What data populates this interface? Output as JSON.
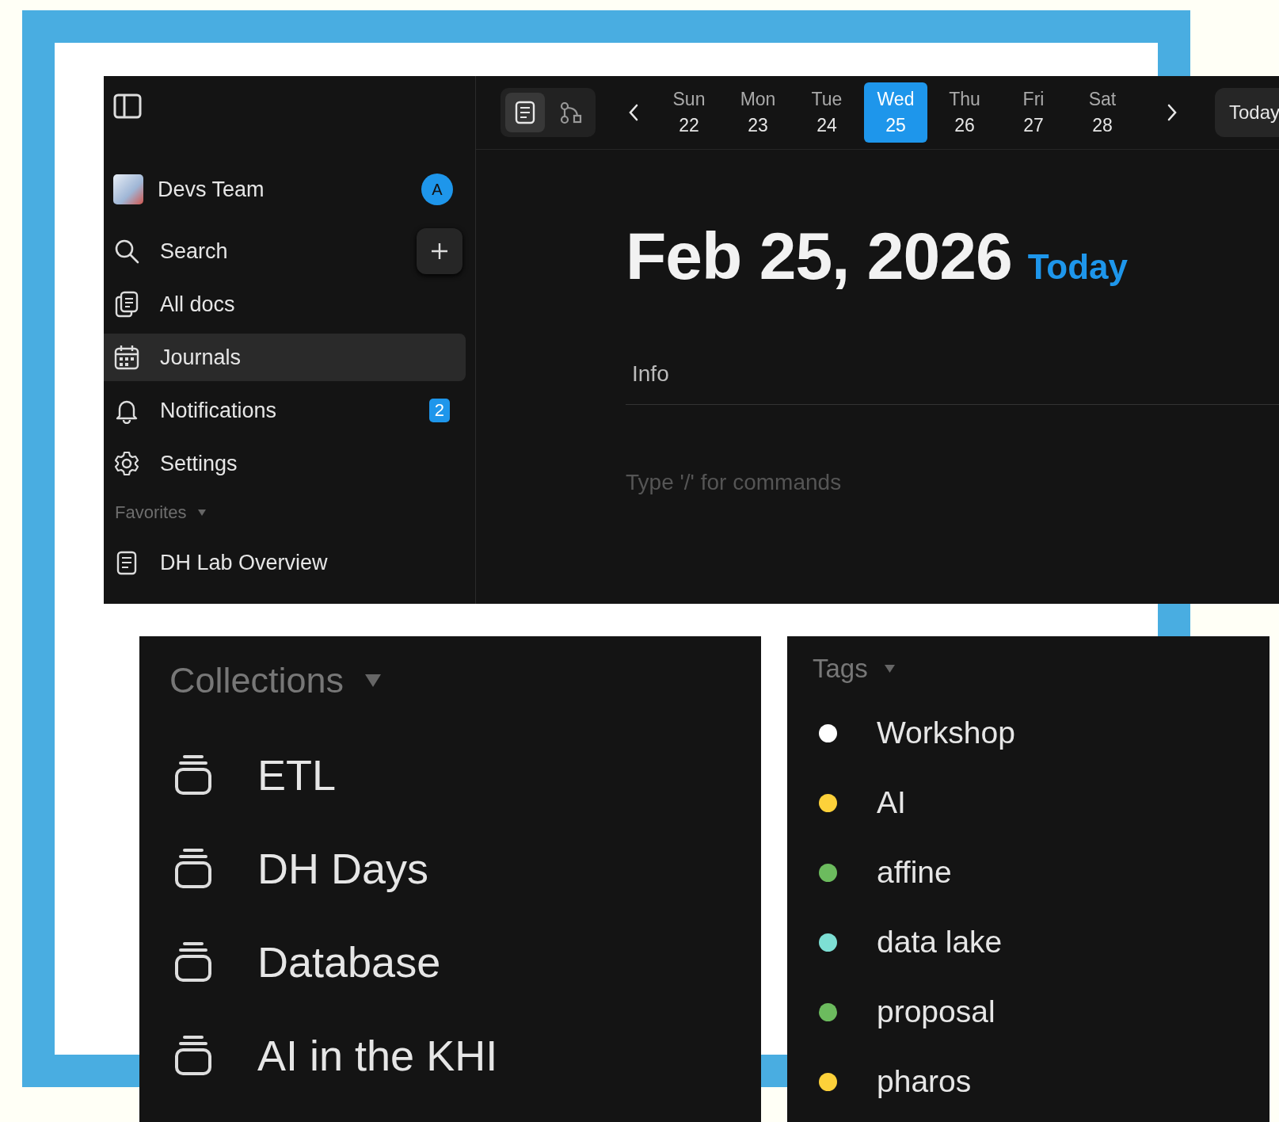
{
  "sidebar": {
    "workspace": {
      "name": "Devs Team",
      "avatar_letter": "A"
    },
    "search": {
      "label": "Search"
    },
    "nav_items": [
      {
        "kind": "docs",
        "label": "All docs",
        "selected": false
      },
      {
        "kind": "calendar",
        "label": "Journals",
        "selected": true
      },
      {
        "kind": "bell",
        "label": "Notifications",
        "selected": false,
        "badge": "2"
      },
      {
        "kind": "gear",
        "label": "Settings",
        "selected": false
      }
    ],
    "favorites": {
      "title": "Favorites",
      "items": [
        {
          "label": "DH Lab Overview"
        }
      ]
    }
  },
  "toolbar": {
    "view_modes": [
      {
        "kind": "page",
        "selected": true
      },
      {
        "kind": "edgeless",
        "selected": false
      }
    ],
    "days": [
      {
        "weekday": "Sun",
        "day": "22",
        "selected": false
      },
      {
        "weekday": "Mon",
        "day": "23",
        "selected": false
      },
      {
        "weekday": "Tue",
        "day": "24",
        "selected": false
      },
      {
        "weekday": "Wed",
        "day": "25",
        "selected": true
      },
      {
        "weekday": "Thu",
        "day": "26",
        "selected": false
      },
      {
        "weekday": "Fri",
        "day": "27",
        "selected": false
      },
      {
        "weekday": "Sat",
        "day": "28",
        "selected": false
      }
    ],
    "today_button": "Today"
  },
  "journal": {
    "date": "Feb 25, 2026",
    "today_label": "Today",
    "info_label": "Info",
    "placeholder": "Type '/' for commands"
  },
  "collections": {
    "title": "Collections",
    "items": [
      {
        "label": "ETL"
      },
      {
        "label": "DH Days"
      },
      {
        "label": "Database"
      },
      {
        "label": "AI in the KHI"
      }
    ]
  },
  "tags": {
    "title": "Tags",
    "items": [
      {
        "name": "Workshop",
        "color": "#ffffff"
      },
      {
        "name": "AI",
        "color": "#fdd13a"
      },
      {
        "name": "affine",
        "color": "#6cbb5e"
      },
      {
        "name": "data lake",
        "color": "#7ddfd4"
      },
      {
        "name": "proposal",
        "color": "#6cbb5e"
      },
      {
        "name": "pharos",
        "color": "#fdd13a"
      }
    ]
  }
}
